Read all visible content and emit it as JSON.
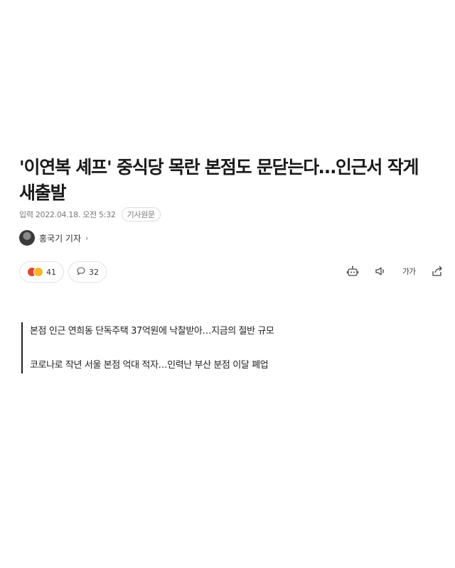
{
  "article": {
    "headline_line1": "'이연복 셰프' 중식당 목란 본점도 문닫는다…인근서 작게",
    "headline_line2": "새출발",
    "published": "입력 2022.04.18. 오전 5:32",
    "original_button": "기사원문",
    "reporter": "홍국기 기자",
    "reporter_chevron": "›"
  },
  "reactions": {
    "emotion_count": "41",
    "comment_count": "32"
  },
  "toolbar": {
    "icons": [
      "robot-summary-icon",
      "speaker-icon",
      "font-size-icon",
      "share-icon",
      "print-icon"
    ],
    "font_size_label": "가가"
  },
  "summary": {
    "items": [
      "본점 인근 연희동 단독주택 37억원에 낙찰받아…지금의 절반 규모",
      "코로나로 작년 서울 본점 억대 적자…인력난 부산 분점 이달 폐업"
    ]
  },
  "colors": {
    "text": "#1a1a1a",
    "meta": "#777777",
    "border": "#e2e2e2",
    "angry": "#e2452f",
    "sad": "#f5b72c"
  }
}
